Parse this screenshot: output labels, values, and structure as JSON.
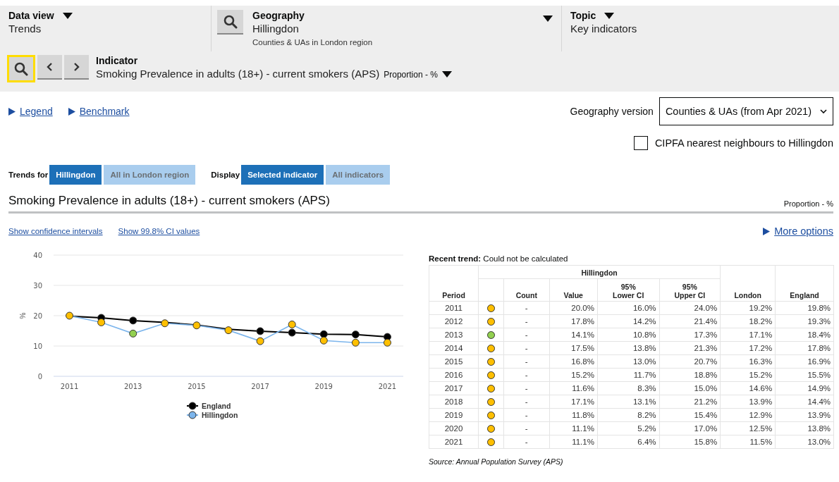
{
  "header": {
    "data_view": {
      "label": "Data view",
      "value": "Trends"
    },
    "geography": {
      "label": "Geography",
      "value": "Hillingdon",
      "subtitle": "Counties & UAs in London region"
    },
    "topic": {
      "label": "Topic",
      "value": "Key indicators"
    },
    "indicator": {
      "label": "Indicator",
      "value": "Smoking Prevalence in adults (18+) - current smokers (APS)",
      "unit": "Proportion - %"
    }
  },
  "links": [
    "Legend",
    "Benchmark"
  ],
  "geography_version": {
    "label": "Geography version",
    "value": "Counties & UAs (from Apr 2021)"
  },
  "cipfa": {
    "label": "CIPFA nearest neighbours to Hillingdon",
    "checked": false
  },
  "trends_for": {
    "label": "Trends for",
    "options": [
      {
        "label": "Hillingdon",
        "selected": true
      },
      {
        "label": "All in London region",
        "selected": false
      }
    ]
  },
  "display": {
    "label": "Display",
    "options": [
      {
        "label": "Selected indicator",
        "selected": true
      },
      {
        "label": "All indicators",
        "selected": false
      }
    ]
  },
  "indicator_title": "Smoking Prevalence in adults (18+) - current smokers (APS)",
  "indicator_unit": "Proportion - %",
  "ci_links": [
    "Show confidence intervals",
    "Show 99.8% CI values"
  ],
  "more_options": "More options",
  "chart_data": {
    "type": "line",
    "ylabel": "%",
    "xlim": [
      2010.5,
      2021.5
    ],
    "grid": "y",
    "legend": "bottom",
    "x": [
      2011,
      2012,
      2013,
      2014,
      2015,
      2016,
      2017,
      2018,
      2019,
      2020,
      2021
    ],
    "xticks": [
      2011,
      2013,
      2015,
      2017,
      2019,
      2021
    ],
    "ylim": [
      0,
      40
    ],
    "yticks": [
      0,
      10,
      20,
      30,
      40
    ],
    "series": [
      {
        "name": "England",
        "color": "#000000",
        "marker": "circle",
        "values": [
          19.8,
          19.3,
          18.4,
          17.8,
          16.9,
          15.5,
          14.9,
          14.4,
          13.9,
          13.8,
          13.0
        ]
      },
      {
        "name": "Hillingdon",
        "color": "#7cb5ec",
        "marker": "circle",
        "values": [
          20.0,
          17.8,
          14.1,
          17.5,
          16.8,
          15.2,
          11.6,
          17.1,
          11.8,
          11.1,
          11.1
        ]
      }
    ]
  },
  "recent_trend": {
    "label": "Recent trend:",
    "value": "Could not be calculated"
  },
  "table": {
    "group_header": "Hillingdon",
    "columns": [
      "Period",
      "Count",
      "Value",
      "95%\nLower CI",
      "95%\nUpper CI",
      "London",
      "England"
    ],
    "rows": [
      {
        "period": "2011",
        "color": "#ffbf00",
        "count": "-",
        "value": "20.0%",
        "lower": "16.0%",
        "upper": "24.0%",
        "london": "19.2%",
        "england": "19.8%"
      },
      {
        "period": "2012",
        "color": "#ffbf00",
        "count": "-",
        "value": "17.8%",
        "lower": "14.2%",
        "upper": "21.4%",
        "london": "18.2%",
        "england": "19.3%"
      },
      {
        "period": "2013",
        "color": "#92d050",
        "count": "-",
        "value": "14.1%",
        "lower": "10.8%",
        "upper": "17.3%",
        "london": "17.1%",
        "england": "18.4%"
      },
      {
        "period": "2014",
        "color": "#ffbf00",
        "count": "-",
        "value": "17.5%",
        "lower": "13.8%",
        "upper": "21.3%",
        "london": "17.2%",
        "england": "17.8%"
      },
      {
        "period": "2015",
        "color": "#ffbf00",
        "count": "-",
        "value": "16.8%",
        "lower": "13.0%",
        "upper": "20.7%",
        "london": "16.3%",
        "england": "16.9%"
      },
      {
        "period": "2016",
        "color": "#ffbf00",
        "count": "-",
        "value": "15.2%",
        "lower": "11.7%",
        "upper": "18.8%",
        "london": "15.2%",
        "england": "15.5%"
      },
      {
        "period": "2017",
        "color": "#ffbf00",
        "count": "-",
        "value": "11.6%",
        "lower": "8.3%",
        "upper": "15.0%",
        "london": "14.6%",
        "england": "14.9%"
      },
      {
        "period": "2018",
        "color": "#ffbf00",
        "count": "-",
        "value": "17.1%",
        "lower": "13.1%",
        "upper": "21.2%",
        "london": "13.9%",
        "england": "14.4%"
      },
      {
        "period": "2019",
        "color": "#ffbf00",
        "count": "-",
        "value": "11.8%",
        "lower": "8.2%",
        "upper": "15.4%",
        "london": "12.9%",
        "england": "13.9%"
      },
      {
        "period": "2020",
        "color": "#ffbf00",
        "count": "-",
        "value": "11.1%",
        "lower": "5.2%",
        "upper": "17.0%",
        "london": "12.5%",
        "england": "13.8%"
      },
      {
        "period": "2021",
        "color": "#ffbf00",
        "count": "-",
        "value": "11.1%",
        "lower": "6.4%",
        "upper": "15.8%",
        "london": "11.5%",
        "england": "13.0%"
      }
    ]
  },
  "source": "Source: Annual Population Survey (APS)"
}
